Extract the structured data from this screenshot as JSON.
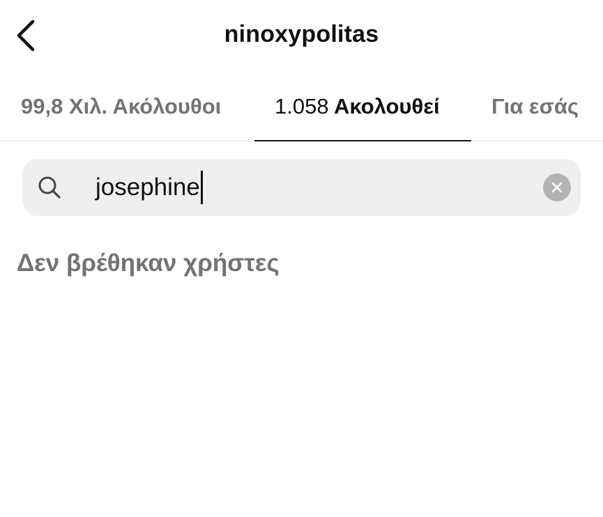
{
  "header": {
    "title": "ninoxypolitas",
    "back_icon": "chevron-left-icon"
  },
  "tabs": [
    {
      "label": "99,8 Χιλ. Ακόλουθοι",
      "active": false
    },
    {
      "count": "1.058",
      "label": "Ακολουθεί",
      "active": true
    },
    {
      "label": "Για εσάς",
      "active": false
    }
  ],
  "search": {
    "value": "josephine",
    "icon": "search-icon",
    "clear_icon": "clear-icon"
  },
  "results": {
    "empty_message": "Δεν βρέθηκαν χρήστες"
  },
  "colors": {
    "text_primary": "#111111",
    "text_secondary": "#737373",
    "search_background": "#efefef",
    "clear_button": "#b3b3b3",
    "divider": "#dcdcdc"
  }
}
